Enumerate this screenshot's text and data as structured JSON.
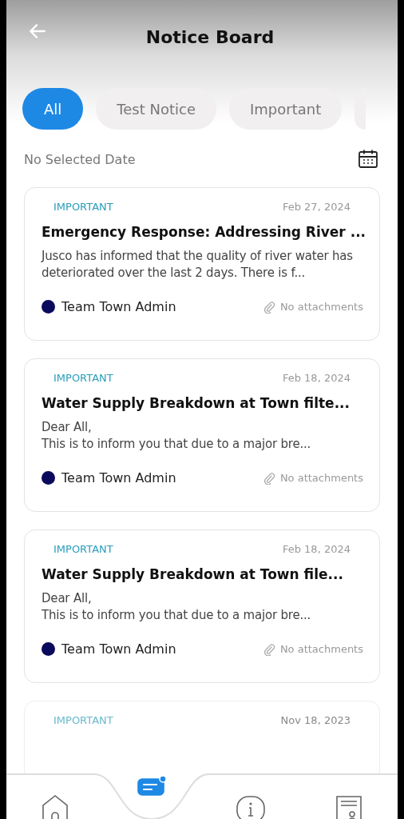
{
  "header": {
    "title": "Notice Board"
  },
  "filters": [
    {
      "label": "All",
      "selected": true
    },
    {
      "label": "Test Notice",
      "selected": false
    },
    {
      "label": "Important",
      "selected": false
    }
  ],
  "date_filter": {
    "placeholder": "No Selected Date"
  },
  "notices": [
    {
      "tag": "IMPORTANT",
      "date": "Feb 27, 2024",
      "title": "Emergency Response: Addressing River ...",
      "body": "Jusco has informed that the quality of river water has deteriorated over the last 2 days. There is f...",
      "author": "Team Town Admin",
      "attachments": "No attachments"
    },
    {
      "tag": "IMPORTANT",
      "date": "Feb 18, 2024",
      "title": "Water Supply Breakdown at Town filte...",
      "body": "Dear All,\nThis is to inform you that due to a major bre...",
      "author": "Team Town Admin",
      "attachments": "No attachments"
    },
    {
      "tag": "IMPORTANT",
      "date": "Feb 18, 2024",
      "title": "Water Supply Breakdown at Town file...",
      "body": "Dear All,\nThis is to inform you that due to a major bre...",
      "author": "Team Town Admin",
      "attachments": "No attachments"
    },
    {
      "tag": "IMPORTANT",
      "date": "Nov 18, 2023"
    }
  ],
  "nav": [
    {
      "kind": "home",
      "selected": false
    },
    {
      "kind": "notices",
      "selected": true
    },
    {
      "kind": "info",
      "selected": false
    },
    {
      "kind": "profile",
      "selected": false
    }
  ]
}
